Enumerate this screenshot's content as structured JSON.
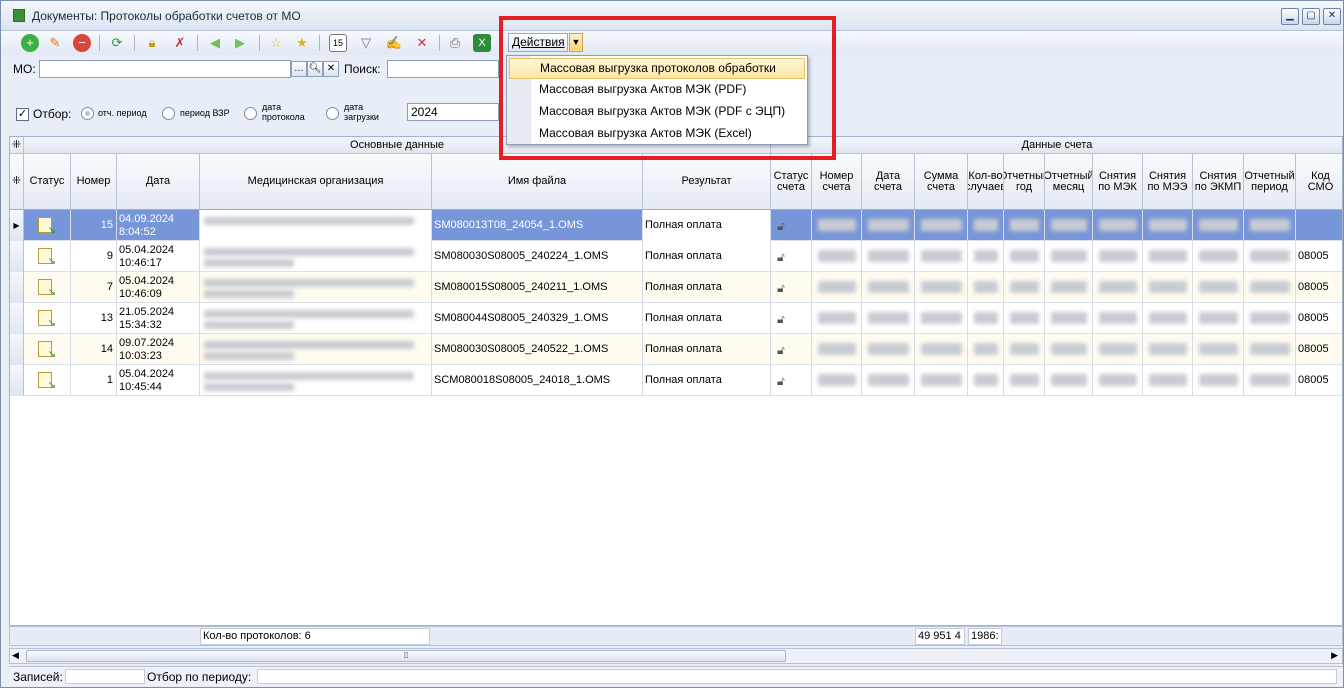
{
  "window": {
    "title": "Документы: Протоколы обработки счетов от МО"
  },
  "toolbar": {
    "actions_label": "Действия",
    "icons": [
      "add-icon",
      "edit-icon",
      "delete-icon",
      "refresh-icon",
      "lock-icon",
      "unlock-icon",
      "back-icon",
      "forward-icon",
      "favorite-icon",
      "favorites-icon",
      "calendar-icon",
      "filter-icon",
      "filter-edit-icon",
      "filter-clear-icon",
      "print-icon",
      "excel-icon"
    ],
    "calendar_day": "15"
  },
  "filters": {
    "mo_label": "МО:",
    "mo_value": "",
    "search_label": "Поиск:",
    "search_value": ""
  },
  "selection": {
    "filter_label": "Отбор:",
    "options": [
      {
        "label": "отч. период",
        "selected": true
      },
      {
        "label": "период ВЗР",
        "selected": false
      },
      {
        "label": "дата протокола",
        "selected": false
      },
      {
        "label": "дата загрузки",
        "selected": false
      }
    ],
    "year": "2024"
  },
  "menu": {
    "items": [
      "Массовая выгрузка протоколов обработки",
      "Массовая выгрузка Актов МЭК (PDF)",
      "Массовая выгрузка Актов МЭК (PDF с ЭЦП)",
      "Массовая выгрузка Актов МЭК (Excel)"
    ]
  },
  "grid": {
    "band_main": "Основные данные",
    "band_account": "Данные счета",
    "columns": [
      "Статус",
      "Номер",
      "Дата",
      "Медицинская организация",
      "Имя файла",
      "Результат",
      "Статус счета",
      "Номер счета",
      "Дата счета",
      "Сумма счета",
      "Кол-во случаев",
      "Отчетный год",
      "Отчетный месяц",
      "Снятия по МЭК",
      "Снятия по МЭЭ",
      "Снятия по ЭКМП",
      "Отчетный период",
      "Код СМО"
    ],
    "rows": [
      {
        "num": "15",
        "date": "04.09.2024",
        "time": "8:04:52",
        "file": "SM080013T08_24054_1.OMS",
        "result": "Полная оплата",
        "smo": ""
      },
      {
        "num": "9",
        "date": "05.04.2024",
        "time": "10:46:17",
        "file": "SM080030S08005_240224_1.OMS",
        "result": "Полная оплата",
        "smo": "08005"
      },
      {
        "num": "7",
        "date": "05.04.2024",
        "time": "10:46:09",
        "file": "SM080015S08005_240211_1.OMS",
        "result": "Полная оплата",
        "smo": "08005"
      },
      {
        "num": "13",
        "date": "21.05.2024",
        "time": "15:34:32",
        "file": "SM080044S08005_240329_1.OMS",
        "result": "Полная оплата",
        "smo": "08005"
      },
      {
        "num": "14",
        "date": "09.07.2024",
        "time": "10:03:23",
        "file": "SM080030S08005_240522_1.OMS",
        "result": "Полная оплата",
        "smo": "08005"
      },
      {
        "num": "1",
        "date": "05.04.2024",
        "time": "10:45:44",
        "file": "SCM080018S08005_24018_1.OMS",
        "result": "Полная оплата",
        "smo": "08005"
      }
    ]
  },
  "footer": {
    "count_label": "Кол-во протоколов: 6",
    "sum_total": "49 951 4",
    "cases_total": "1986:"
  },
  "statusbar": {
    "records_label": "Записей:",
    "period_label": "Отбор по периоду:"
  }
}
